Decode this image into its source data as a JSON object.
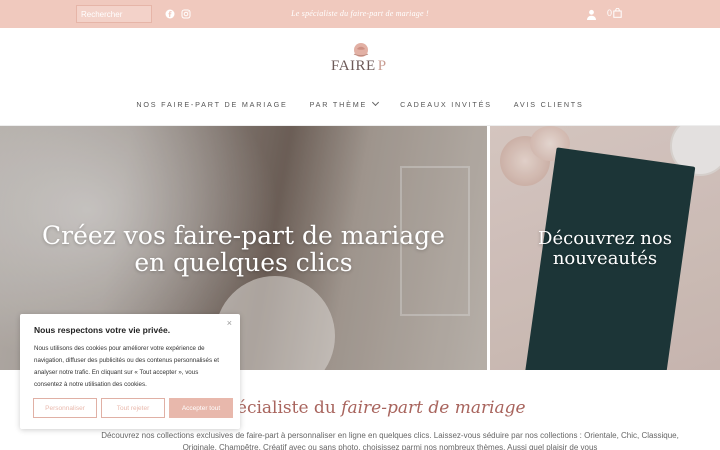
{
  "topbar": {
    "search_placeholder": "Rechercher",
    "tagline": "Le spécialiste du faire-part de mariage !",
    "cart_count": "0"
  },
  "logo": {
    "text_main": "FAIRE",
    "text_p": "P"
  },
  "nav": {
    "items": [
      {
        "label": "NOS FAIRE-PART DE MARIAGE"
      },
      {
        "label": "PAR THÈME"
      },
      {
        "label": "CADEAUX INVITÉS"
      },
      {
        "label": "AVIS CLIENTS"
      }
    ]
  },
  "hero": {
    "left_title_line1": "Créez vos faire-part de mariage",
    "left_title_line2": "en quelques clics",
    "right_title_line1": "Découvrez nos",
    "right_title_line2": "nouveautés"
  },
  "section": {
    "title_prefix": "pécialiste du",
    "title_emph": "faire-part de mariage",
    "body": "Découvrez nos collections exclusives de faire-part à personnaliser en ligne en quelques clics. Laissez-vous séduire par nos collections : Orientale, Chic, Classique, Originale, Champêtre, Créatif avec ou sans photo, choisissez parmi nos nombreux thèmes. Aussi quel plaisir de vous"
  },
  "cookie": {
    "title": "Nous respectons votre vie privée.",
    "text": "Nous utilisons des cookies pour améliorer votre expérience de navigation, diffuser des publicités ou des contenus personnalisés et analyser notre trafic. En cliquant sur « Tout accepter », vous consentez à notre utilisation des cookies.",
    "close": "×",
    "btn_customize": "Personnaliser",
    "btn_reject": "Tout rejeter",
    "btn_accept": "Accepter tout"
  },
  "colors": {
    "topbar": "#f0c9be",
    "accent": "#e8b8ac",
    "title": "#a8645d"
  }
}
